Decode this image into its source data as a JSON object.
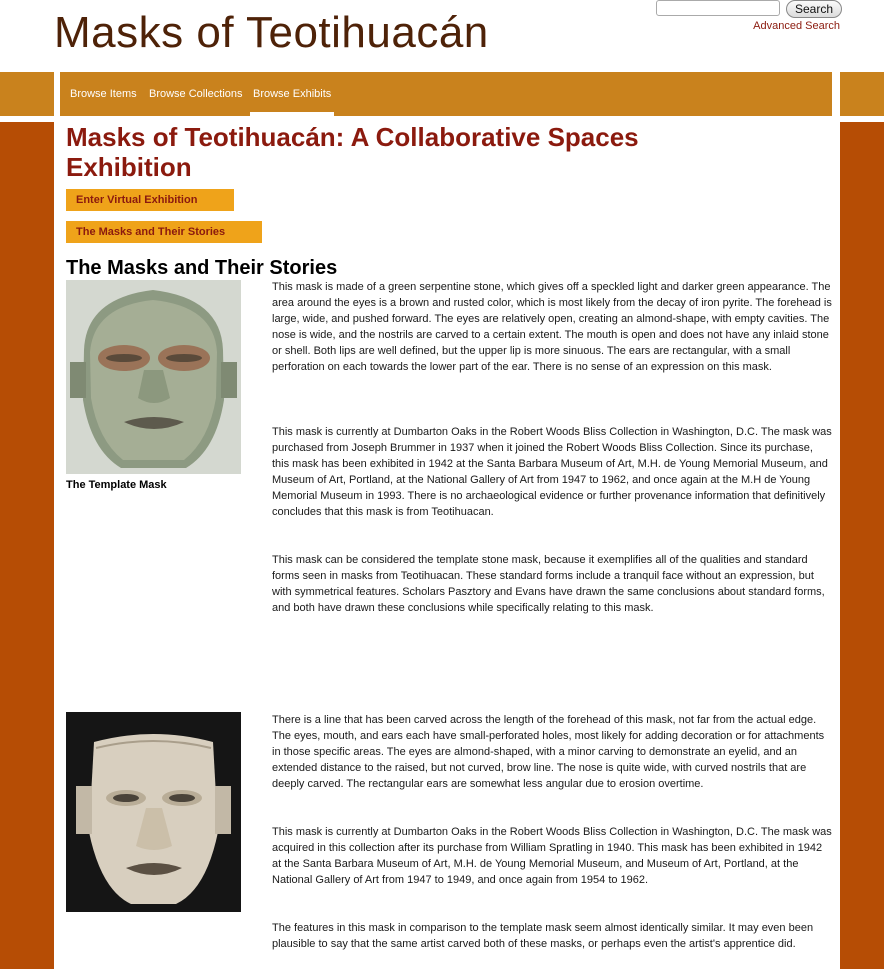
{
  "site": {
    "title": "Masks of Teotihuacán",
    "search_button": "Search",
    "advanced_search": "Advanced Search"
  },
  "nav": {
    "items": [
      "Browse Items",
      "Browse Collections",
      "Browse Exhibits"
    ],
    "active": "Browse Exhibits"
  },
  "page": {
    "title": "Masks of Teotihuacán: A Collaborative Spaces Exhibition",
    "enter_button": "Enter Virtual Exhibition",
    "stories_button": "The Masks and Their Stories",
    "section_heading": "The Masks and Their Stories"
  },
  "masks": [
    {
      "caption": "The Template Mask",
      "paragraphs": [
        "This mask is made of a green serpentine stone, which gives off a speckled light and darker green appearance.  The area around the eyes is a brown and rusted color, which is most likely from the decay of iron pyrite.  The forehead is large, wide, and pushed forward.  The eyes are relatively open, creating an almond-shape, with empty cavities.  The nose is wide, and the nostrils are carved to a certain extent.  The mouth is open and does not have any inlaid stone or shell.  Both lips are well defined, but the upper lip is more sinuous.  The ears are rectangular, with a small perforation on each towards the lower part of the ear.  There is no sense of an expression on this mask.",
        "This mask is currently at Dumbarton Oaks in the Robert Woods Bliss Collection in Washington, D.C.  The mask was purchased from Joseph Brummer in 1937 when it joined the Robert Woods Bliss Collection.  Since its purchase, this mask has been exhibited in 1942 at the Santa Barbara Museum of Art, M.H. de Young Memorial Museum, and Museum of Art, Portland, at the National Gallery of Art from 1947 to 1962, and once again at the M.H de Young Memorial Museum in 1993.  There is no archaeological evidence or further provenance information that definitively concludes that this mask is from Teotihuacan.",
        "This mask can be considered the template stone mask, because it exemplifies all of the qualities and standard forms seen in masks from Teotihuacan.  These standard forms include a tranquil face without an expression, but with symmetrical features.  Scholars Pasztory and Evans have drawn the same conclusions about standard forms, and both have drawn these conclusions while specifically relating to this mask."
      ]
    },
    {
      "paragraphs": [
        "There is a line that has been carved across the length of the forehead of this mask, not far from the actual edge.  The eyes, mouth, and ears each have small-perforated holes, most likely for adding decoration or for attachments in those specific areas.  The eyes are almond-shaped, with a minor carving to demonstrate an eyelid, and an extended distance to the raised, but not curved, brow line.  The nose is quite wide, with curved nostrils that are deeply carved.  The rectangular ears are somewhat less angular due to erosion overtime.",
        "This mask is currently at Dumbarton Oaks in the Robert Woods Bliss Collection in Washington, D.C.  The mask was acquired in this collection after its purchase from William Spratling in 1940.  This mask has been exhibited in 1942 at the Santa Barbara Museum of Art, M.H. de Young Memorial Museum, and Museum of Art, Portland, at the National Gallery of Art from 1947 to 1949, and once again from 1954 to 1962.",
        "The features in this mask in comparison to the template mask seem almost identically similar.  It may even been plausible to say that the same artist carved both of these masks, or perhaps even the artist's apprentice did."
      ]
    }
  ],
  "colors": {
    "brand_brown": "#4e2208",
    "title_red": "#8b1a0e",
    "nav_orange": "#c9821d",
    "side_rust": "#b64d05",
    "button_gold": "#efa31a"
  }
}
